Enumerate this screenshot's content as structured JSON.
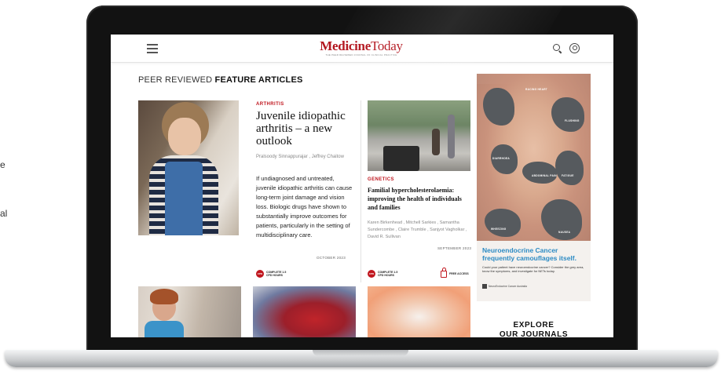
{
  "left_fragments": [
    "e",
    "al"
  ],
  "header": {
    "logo_main_bold": "Medicine",
    "logo_main_light": "Today",
    "logo_tagline": "THE PEER REVIEWED JOURNAL OF CLINICAL PRACTICE"
  },
  "section": {
    "title_light": "PEER REVIEWED ",
    "title_bold": "FEATURE ARTICLES"
  },
  "articles": [
    {
      "category": "ARTHRITIS",
      "title": "Juvenile idiopathic arthritis – a new outlook",
      "authors": "Pralsoody Sinnappurajar , Jeffrey Chaitow",
      "excerpt": "If undiagnosed and untreated, juvenile idiopathic arthritis can cause long-term joint damage and vision loss. Biologic drugs have shown to substantially improve outcomes for patients, particularly in the setting of multidisciplinary care.",
      "date": "OCTOBER 2023",
      "cpd_badge": "CPD",
      "cpd_label": "COMPLETE 1.5 CPD HOURS"
    },
    {
      "category": "GENETICS",
      "title": "Familial hypercholesterolaemia: improving the health of individuals and families",
      "authors": "Karen Birkenhead , Mitchell Sarkies , Samantha Sundercombe , Claire Trumble , Sanjyot Vagholkar , David R. Sullivan",
      "date": "SEPTEMBER 2023",
      "cpd_badge": "CPD",
      "cpd_label": "COMPLETE 1.5 CPD HOURS",
      "free_access": "FREE ACCESS"
    }
  ],
  "advert": {
    "labels": [
      "RACING HEART",
      "FLUSHING",
      "DIARRHOEA",
      "ABDOMINAL PAIN",
      "FATIGUE",
      "WHEEZING",
      "NAUSEA"
    ],
    "headline": "Neuroendocrine Cancer frequently camouflages itself.",
    "copy": "Could your patient have neuroendocrine cancer? Consider the grey area, know the symptoms, and investigate for NETs today.",
    "brand": "NeuroEndocrine Cancer Australia"
  },
  "explore": {
    "line1": "EXPLORE",
    "line2": "OUR JOURNALS"
  }
}
